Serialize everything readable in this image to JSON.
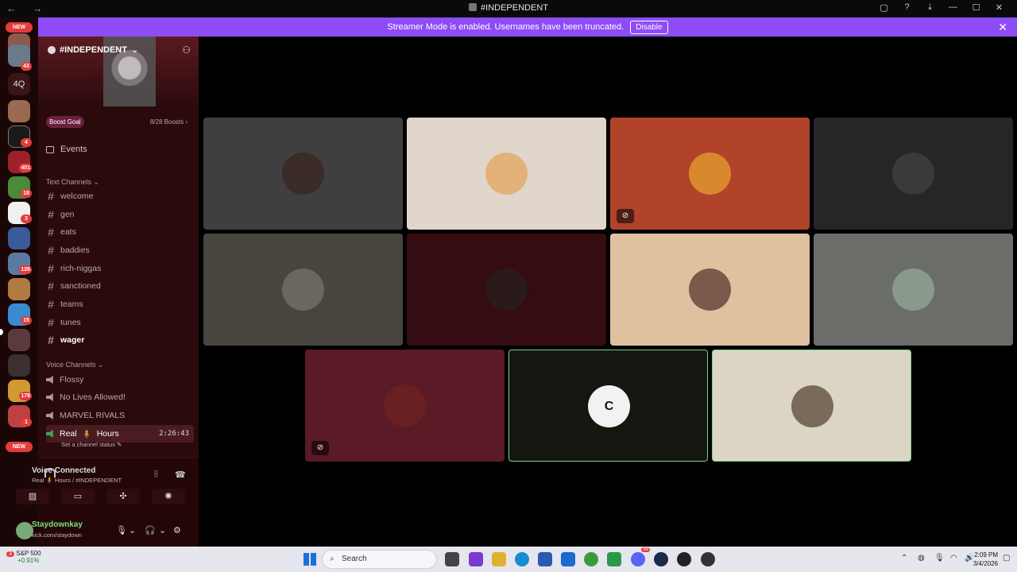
{
  "window": {
    "title": "#INDEPENDENT",
    "nav": "← →"
  },
  "banner": {
    "text": "Streamer Mode is enabled. Usernames have been truncated.",
    "button": "Disable"
  },
  "rail": {
    "new_label_top": "NEW",
    "new_label_bottom": "NEW",
    "badges": [
      "43",
      "4",
      "401",
      "18",
      "3",
      "126",
      "15",
      "178",
      "1"
    ],
    "text_server": "4Q"
  },
  "server": {
    "name": "#INDEPENDENT",
    "boost_goal": "Boost Goal",
    "boosts": "8/28 Boosts",
    "events": "Events"
  },
  "text_channels": {
    "category": "Text Channels",
    "items": [
      "welcome",
      "gen",
      "eats",
      "baddies",
      "rich-niggas",
      "sanctioned",
      "teams",
      "tunes",
      "wager"
    ]
  },
  "voice_channels": {
    "category": "Voice Channels",
    "items": [
      "Flossy",
      "No Lives Allowed!",
      "MARVEL RIVALS"
    ],
    "active": {
      "name": "Real",
      "name2": "Hours",
      "timer": "2:26:43",
      "status": "Set a channel status"
    }
  },
  "voice_connected": {
    "label": "Voice Connected",
    "channel": "Real 🧍 Hours / #INDEPENDENT"
  },
  "user": {
    "name": "Staydownkay",
    "sub": "kick.com/staydown"
  },
  "tiles": [
    {
      "bg": "#3f3f3f",
      "av": "#3a2a28"
    },
    {
      "bg": "#e0d6cb",
      "av": "#e3b27a"
    },
    {
      "bg": "#b0432a",
      "av": "#d9882e"
    },
    {
      "bg": "#262626",
      "av": "#3a3a3a"
    },
    {
      "bg": "#48453f",
      "av": "#6a6660"
    },
    {
      "bg": "#340c12",
      "av": "#2a1a1a"
    },
    {
      "bg": "#dfc19f",
      "av": "#7a5a4a"
    },
    {
      "bg": "#6a6d68",
      "av": "#8a9a8a"
    },
    {
      "bg": "#5a1a26",
      "av": "#6a2020"
    },
    {
      "bg": "#17150f",
      "av": "#f2f2f2",
      "label": "C"
    },
    {
      "bg": "#dcd5c6",
      "av": "#7a6a5a"
    }
  ],
  "taskbar": {
    "stock_name": "S&P 500",
    "stock_change": "+0.91%",
    "stock_badge": "3",
    "search": "Search",
    "time": "2:09 PM",
    "date": "3/4/2026",
    "discord_badge": "99"
  },
  "colors": {
    "accent": "#8e4cf6",
    "speaking": "#7bd088",
    "sidebar": "#2b0a0c"
  }
}
